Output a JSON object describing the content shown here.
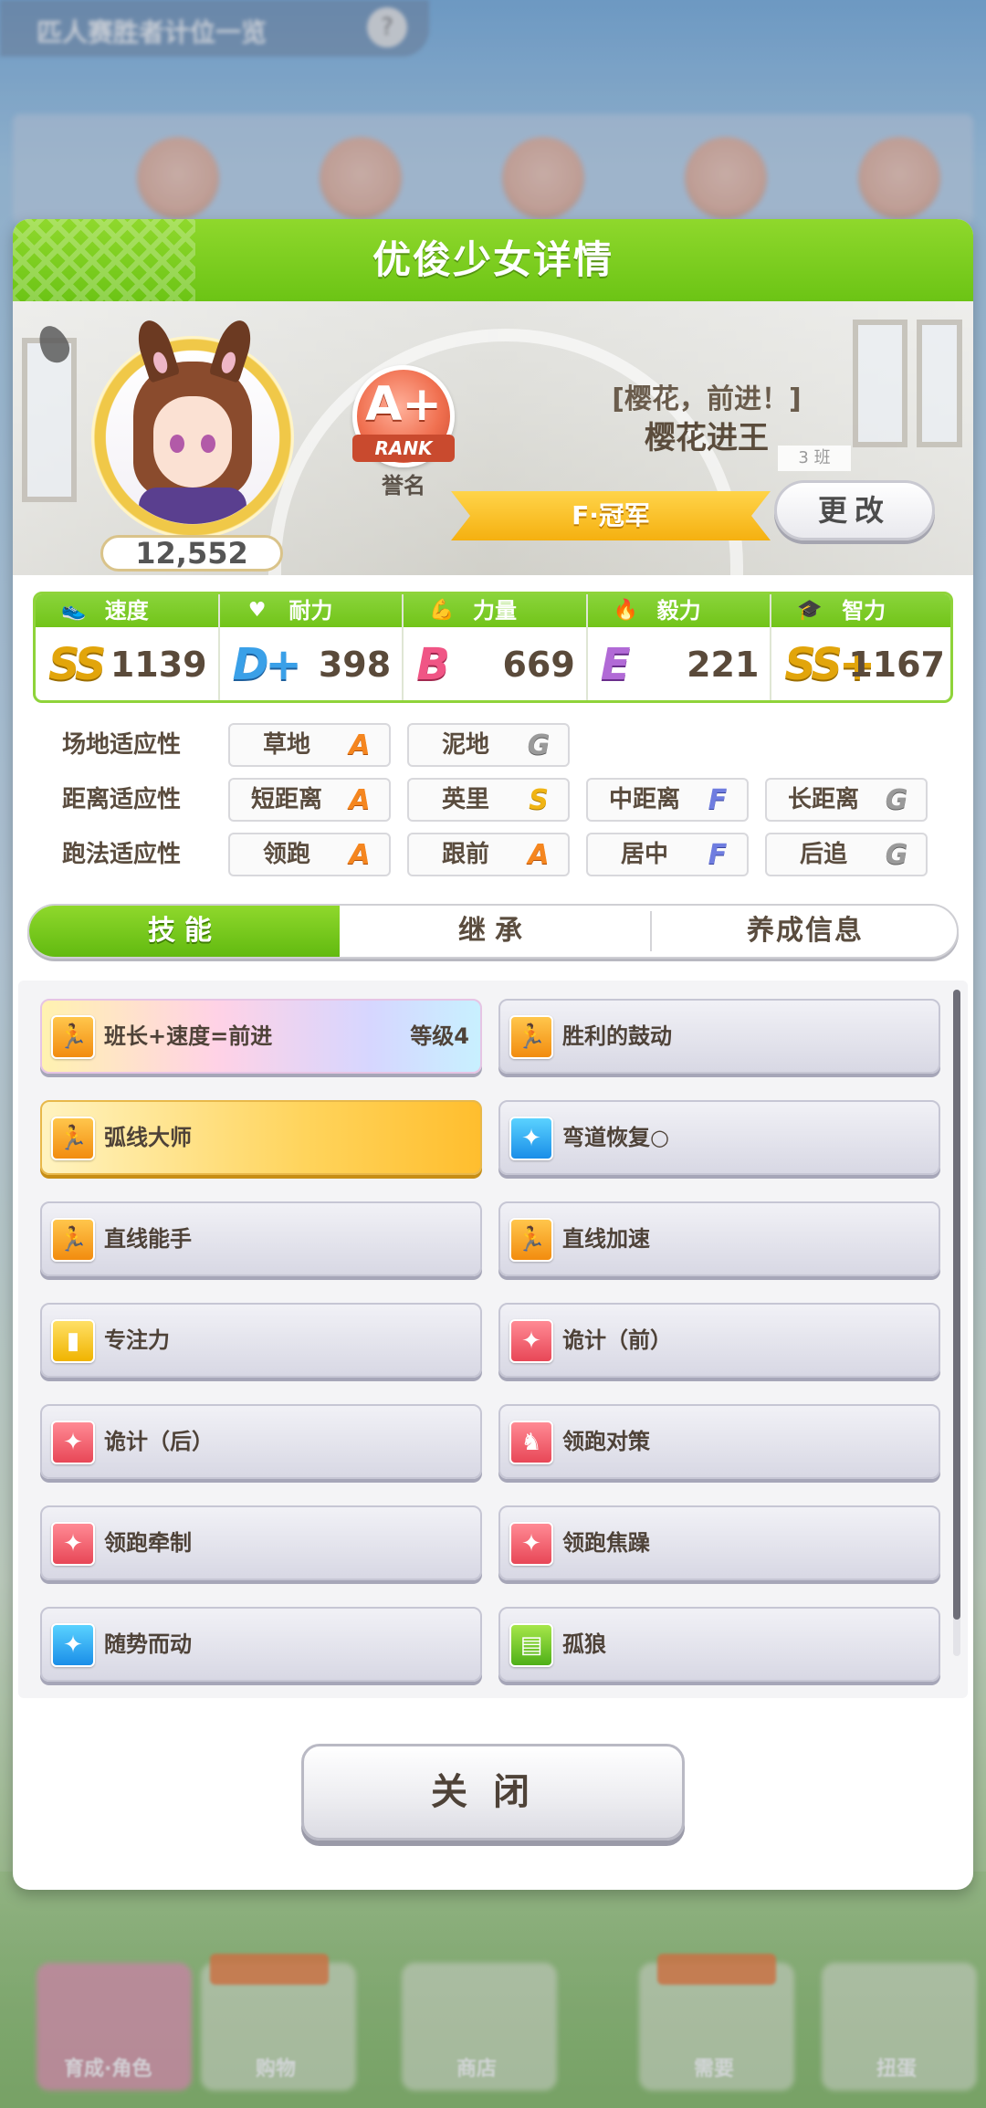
{
  "background": {
    "top_title": "匹人赛胜者计位一览",
    "bottom_tiles": [
      "育成·角色",
      "购物",
      "商店",
      "需要",
      "扭蛋"
    ]
  },
  "dialog": {
    "title": "优俊少女详情",
    "fans": "12,552",
    "rank": {
      "grade": "A+",
      "ribbon": "RANK",
      "label": "誉名"
    },
    "title_bracket": "[樱花，前进！]",
    "title_name": "樱花进王",
    "class_tag": "3 班",
    "title_ribbon": "F·冠军",
    "change_button": "更改",
    "stats": [
      {
        "name": "速度",
        "icon": "shoe-icon",
        "grade": "SS",
        "value": "1139"
      },
      {
        "name": "耐力",
        "icon": "heart-icon",
        "grade": "D+",
        "value": "398"
      },
      {
        "name": "力量",
        "icon": "muscle-icon",
        "grade": "B",
        "value": "669"
      },
      {
        "name": "毅力",
        "icon": "flame-icon",
        "grade": "E",
        "value": "221"
      },
      {
        "name": "智力",
        "icon": "graduation-cap-icon",
        "grade": "SS+",
        "value": "1167"
      }
    ],
    "aptitudes": [
      {
        "label": "场地适应性",
        "cells": [
          {
            "name": "草地",
            "grade": "A"
          },
          {
            "name": "泥地",
            "grade": "G"
          }
        ]
      },
      {
        "label": "距离适应性",
        "cells": [
          {
            "name": "短距离",
            "grade": "A"
          },
          {
            "name": "英里",
            "grade": "S"
          },
          {
            "name": "中距离",
            "grade": "F"
          },
          {
            "name": "长距离",
            "grade": "G"
          }
        ]
      },
      {
        "label": "跑法适应性",
        "cells": [
          {
            "name": "领跑",
            "grade": "A"
          },
          {
            "name": "跟前",
            "grade": "A"
          },
          {
            "name": "居中",
            "grade": "F"
          },
          {
            "name": "后追",
            "grade": "G"
          }
        ]
      }
    ],
    "tabs": [
      "技能",
      "继承",
      "养成信息"
    ],
    "skills": [
      {
        "name": "班长+速度=前进",
        "level": "等级4",
        "style": "rainbow",
        "icon": "ico-orange"
      },
      {
        "name": "胜利的鼓动",
        "level": "",
        "style": "",
        "icon": "ico-orange"
      },
      {
        "name": "弧线大师",
        "level": "",
        "style": "gold",
        "icon": "ico-orange"
      },
      {
        "name": "弯道恢复○",
        "level": "",
        "style": "",
        "icon": "ico-blue"
      },
      {
        "name": "直线能手",
        "level": "",
        "style": "",
        "icon": "ico-orange"
      },
      {
        "name": "直线加速",
        "level": "",
        "style": "",
        "icon": "ico-orange"
      },
      {
        "name": "专注力",
        "level": "",
        "style": "",
        "icon": "ico-yellow"
      },
      {
        "name": "诡计（前）",
        "level": "",
        "style": "",
        "icon": "ico-red"
      },
      {
        "name": "诡计（后）",
        "level": "",
        "style": "",
        "icon": "ico-red"
      },
      {
        "name": "领跑对策",
        "level": "",
        "style": "",
        "icon": "ico-red"
      },
      {
        "name": "领跑牵制",
        "level": "",
        "style": "",
        "icon": "ico-red"
      },
      {
        "name": "领跑焦躁",
        "level": "",
        "style": "",
        "icon": "ico-red"
      },
      {
        "name": "随势而动",
        "level": "",
        "style": "",
        "icon": "ico-blue"
      },
      {
        "name": "孤狼",
        "level": "",
        "style": "",
        "icon": "ico-green"
      }
    ],
    "close_button": "关闭"
  }
}
